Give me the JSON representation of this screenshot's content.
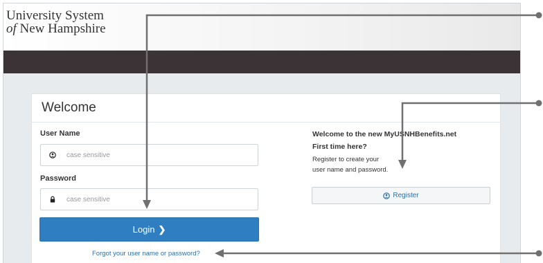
{
  "brand": {
    "line1": "University System",
    "line2_italic": "of",
    "line2_rest": " New Hampshire"
  },
  "login_card": {
    "title": "Welcome",
    "username_label": "User Name",
    "username_placeholder": "case sensitive",
    "username_icon": "user-circle-icon",
    "password_label": "Password",
    "password_placeholder": "case sensitive",
    "password_icon": "lock-icon",
    "login_label": "Login",
    "login_icon": "chevron-right-icon",
    "forgot_link": "Forgot your user name or password?"
  },
  "register_panel": {
    "title_line1": "Welcome to the new MyUSNHBenefits.net",
    "title_line2": "First time here?",
    "text_line1": "Register to create your",
    "text_line2": "user name and password.",
    "register_label": "Register",
    "register_icon": "user-circle-icon"
  },
  "colors": {
    "primary_button": "#2f7ec1",
    "dark_bar": "#3c3337",
    "link": "#2d6ea8",
    "annotation": "#707070"
  }
}
